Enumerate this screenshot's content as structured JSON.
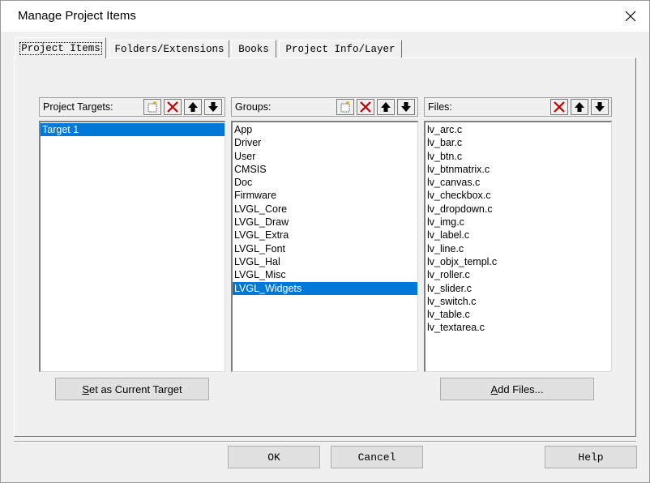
{
  "dialog": {
    "title": "Manage Project Items"
  },
  "tabs": [
    {
      "label": "Project Items",
      "active": true
    },
    {
      "label": "Folders/Extensions",
      "active": false
    },
    {
      "label": "Books",
      "active": false
    },
    {
      "label": "Project Info/Layer",
      "active": false
    }
  ],
  "targets": {
    "label": "Project Targets:",
    "items": [
      "Target 1"
    ],
    "selected": "Target 1"
  },
  "groups": {
    "label": "Groups:",
    "items": [
      "App",
      "Driver",
      "User",
      "CMSIS",
      "Doc",
      "Firmware",
      "LVGL_Core",
      "LVGL_Draw",
      "LVGL_Extra",
      "LVGL_Font",
      "LVGL_Hal",
      "LVGL_Misc",
      "LVGL_Widgets"
    ],
    "selected": "LVGL_Widgets"
  },
  "files": {
    "label": "Files:",
    "items": [
      "lv_arc.c",
      "lv_bar.c",
      "lv_btn.c",
      "lv_btnmatrix.c",
      "lv_canvas.c",
      "lv_checkbox.c",
      "lv_dropdown.c",
      "lv_img.c",
      "lv_label.c",
      "lv_line.c",
      "lv_objx_templ.c",
      "lv_roller.c",
      "lv_slider.c",
      "lv_switch.c",
      "lv_table.c",
      "lv_textarea.c"
    ]
  },
  "buttons": {
    "set_target_prefix": "S",
    "set_target_rest": "et as Current Target",
    "add_files_prefix": "A",
    "add_files_rest": "dd Files...",
    "ok": "OK",
    "cancel": "Cancel",
    "help": "Help"
  },
  "icons": {
    "new": "new-item-icon",
    "delete": "delete-icon",
    "up": "move-up-icon",
    "down": "move-down-icon",
    "close": "close-icon"
  },
  "colors": {
    "selection": "#0078d7",
    "delete_red": "#c00000",
    "background": "#f0f0f0"
  }
}
